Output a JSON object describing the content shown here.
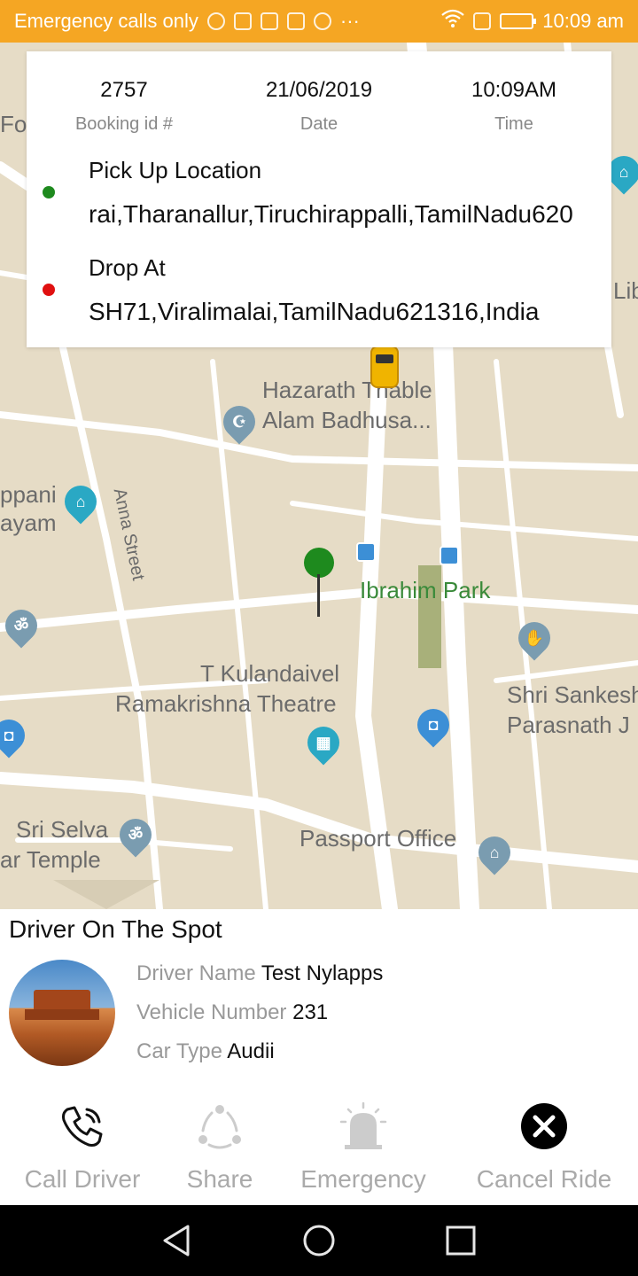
{
  "status_bar": {
    "carrier_text": "Emergency calls only",
    "overflow": "···",
    "time": "10:09 am",
    "icons": [
      "usb-icon",
      "app-icon",
      "youtube-icon",
      "app-icon",
      "chrome-icon",
      "wifi-icon",
      "sim-alert-icon",
      "battery-charging-icon"
    ]
  },
  "map": {
    "labels": {
      "hazarath": "Hazarath Thable",
      "alam": "Alam Badhusa...",
      "anna_street": "Anna Street",
      "ppani": "ppani",
      "ayam": "ayam",
      "ibrahim_park": "Ibrahim Park",
      "kulandaivel": "T Kulandaivel",
      "ramakrishna": "Ramakrishna Theatre",
      "shri_sankesh": "Shri Sankesh",
      "parasnath": "Parasnath J",
      "sri_selva": "Sri Selva",
      "ar_temple": "ar Temple",
      "passport_office": "Passport Office",
      "for": "For",
      "lib": "Lib"
    },
    "colors": {
      "land": "#e6dcc6",
      "road": "#ffffff",
      "park": "#a8b07a",
      "poi": "#2aa8c4"
    }
  },
  "booking": {
    "booking_id": "2757",
    "booking_id_caption": "Booking id #",
    "date": "21/06/2019",
    "date_caption": "Date",
    "time": "10:09AM",
    "time_caption": "Time",
    "pickup_title": "Pick Up Location",
    "pickup_address": "rai,Tharanallur,Tiruchirappalli,TamilNadu620",
    "drop_title": "Drop At",
    "drop_address": "SH71,Viralimalai,TamilNadu621316,India",
    "colors": {
      "pickup": "#1e8a1e",
      "drop": "#e01010"
    }
  },
  "driver": {
    "section_title": "Driver On The Spot",
    "name_label": "Driver Name",
    "name": "Test Nylapps",
    "vehicle_label": "Vehicle Number",
    "vehicle": "231",
    "car_type_label": "Car Type",
    "car_type": "Audii"
  },
  "actions": {
    "call": "Call Driver",
    "share": "Share",
    "emergency": "Emergency",
    "cancel": "Cancel Ride"
  },
  "nav": {
    "icons": [
      "back-icon",
      "home-icon",
      "recents-icon"
    ]
  }
}
